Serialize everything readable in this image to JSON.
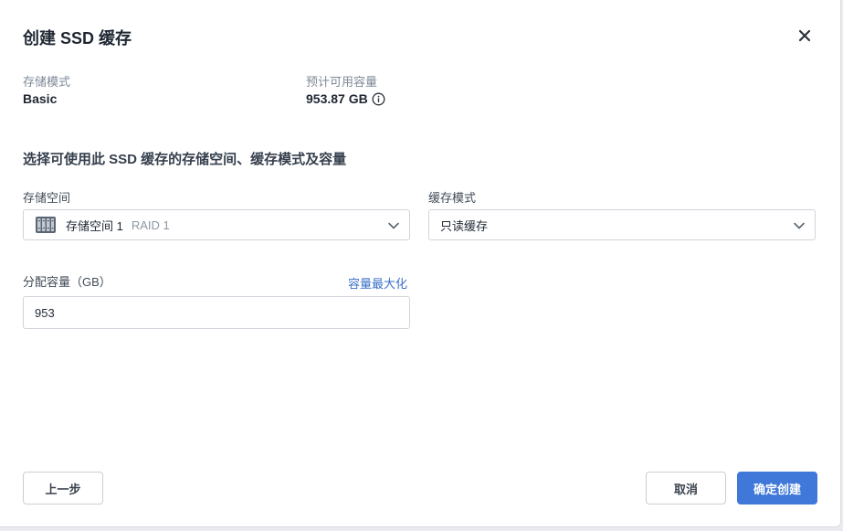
{
  "dialog": {
    "title": "创建 SSD 缓存"
  },
  "summary": {
    "storage_mode_label": "存储模式",
    "storage_mode_value": "Basic",
    "capacity_label": "预计可用容量",
    "capacity_value": "953.87 GB"
  },
  "section": {
    "title": "选择可使用此 SSD 缓存的存储空间、缓存模式及容量"
  },
  "storage_pool": {
    "label": "存储空间",
    "selected_name": "存储空间 1",
    "selected_raid": "RAID 1"
  },
  "cache_mode": {
    "label": "缓存模式",
    "selected": "只读缓存"
  },
  "allocation": {
    "label": "分配容量（GB）",
    "max_link": "容量最大化",
    "value": "953"
  },
  "footer": {
    "back_label": "上一步",
    "cancel_label": "取消",
    "confirm_label": "确定创建"
  },
  "colors": {
    "primary": "#3f78d9",
    "link": "#3a70c9"
  }
}
